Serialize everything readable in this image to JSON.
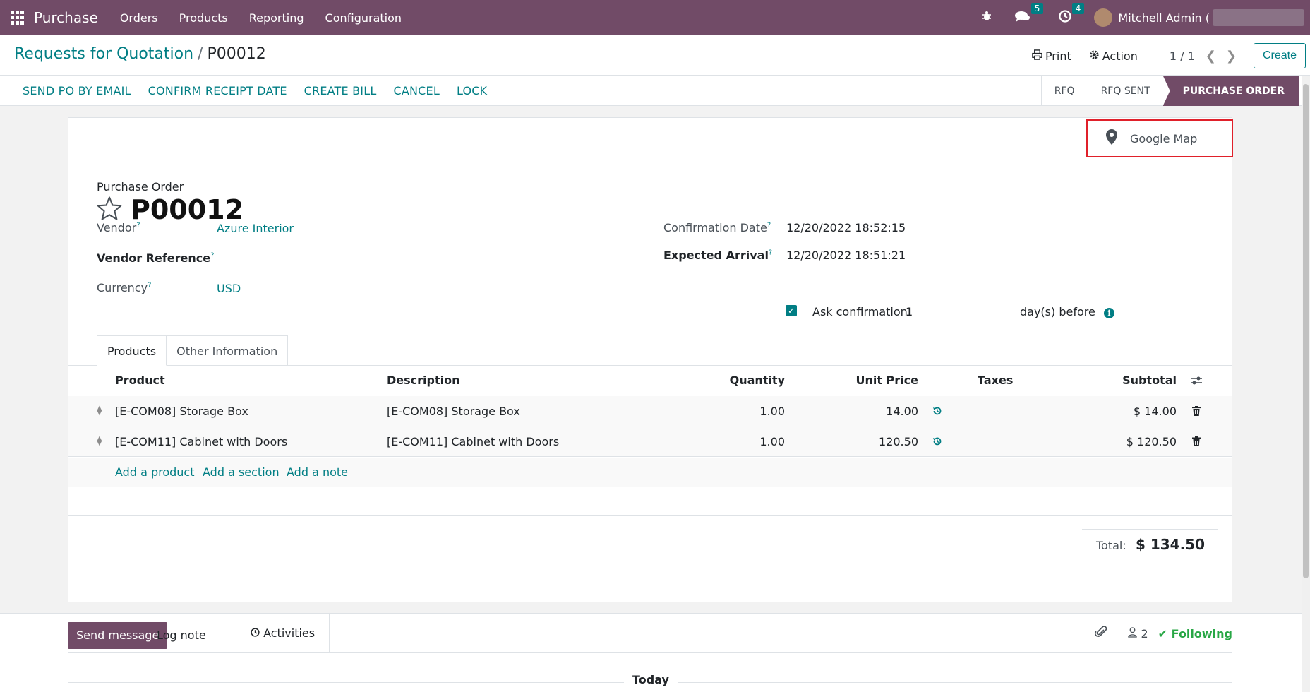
{
  "navbar": {
    "app_name": "Purchase",
    "menus": [
      "Orders",
      "Products",
      "Reporting",
      "Configuration"
    ],
    "messages_count": "5",
    "activities_count": "4",
    "user_name": "Mitchell Admin ("
  },
  "control": {
    "breadcrumb_parent": "Requests for Quotation",
    "breadcrumb_sep": "/",
    "breadcrumb_current": "P00012",
    "print_label": "Print",
    "action_label": "Action",
    "pager": "1 / 1",
    "create_label": "Create"
  },
  "statusbar": {
    "buttons": [
      "SEND PO BY EMAIL",
      "CONFIRM RECEIPT DATE",
      "CREATE BILL",
      "CANCEL",
      "LOCK"
    ],
    "stages": [
      "RFQ",
      "RFQ SENT",
      "PURCHASE ORDER"
    ],
    "active_stage": "PURCHASE ORDER"
  },
  "sheet": {
    "google_map_label": "Google Map",
    "po_label": "Purchase Order",
    "po_name": "P00012",
    "fields": {
      "vendor_label": "Vendor",
      "vendor_value": "Azure Interior",
      "vendor_ref_label": "Vendor Reference",
      "currency_label": "Currency",
      "currency_value": "USD",
      "confirmation_date_label": "Confirmation Date",
      "confirmation_date_value": "12/20/2022 18:52:15",
      "expected_arrival_label": "Expected Arrival",
      "expected_arrival_value": "12/20/2022 18:51:21",
      "ask_confirmation_label": "Ask confirmation",
      "ask_confirmation_days": "1",
      "days_before_label": "day(s) before",
      "ask_confirmation_checked": true
    },
    "help_mark": "?",
    "tabs": [
      "Products",
      "Other Information"
    ],
    "table": {
      "headers": {
        "product": "Product",
        "description": "Description",
        "quantity": "Quantity",
        "unit_price": "Unit Price",
        "taxes": "Taxes",
        "subtotal": "Subtotal"
      },
      "rows": [
        {
          "product": "[E-COM08] Storage Box",
          "description": "[E-COM08] Storage Box",
          "quantity": "1.00",
          "unit_price": "14.00",
          "taxes": "",
          "subtotal": "$ 14.00"
        },
        {
          "product": "[E-COM11] Cabinet with Doors",
          "description": "[E-COM11] Cabinet with Doors",
          "quantity": "1.00",
          "unit_price": "120.50",
          "taxes": "",
          "subtotal": "$ 120.50"
        }
      ],
      "add_links": [
        "Add a product",
        "Add a section",
        "Add a note"
      ]
    },
    "total_label": "Total:",
    "total_value": "$ 134.50"
  },
  "chatter": {
    "send_message": "Send message",
    "log_note": "Log note",
    "activities": "Activities",
    "followers_count": "2",
    "following": "Following",
    "today": "Today"
  },
  "colors": {
    "brand": "#714b67",
    "accent": "#017e84",
    "highlight_border": "#e0202a",
    "following": "#28a745"
  }
}
